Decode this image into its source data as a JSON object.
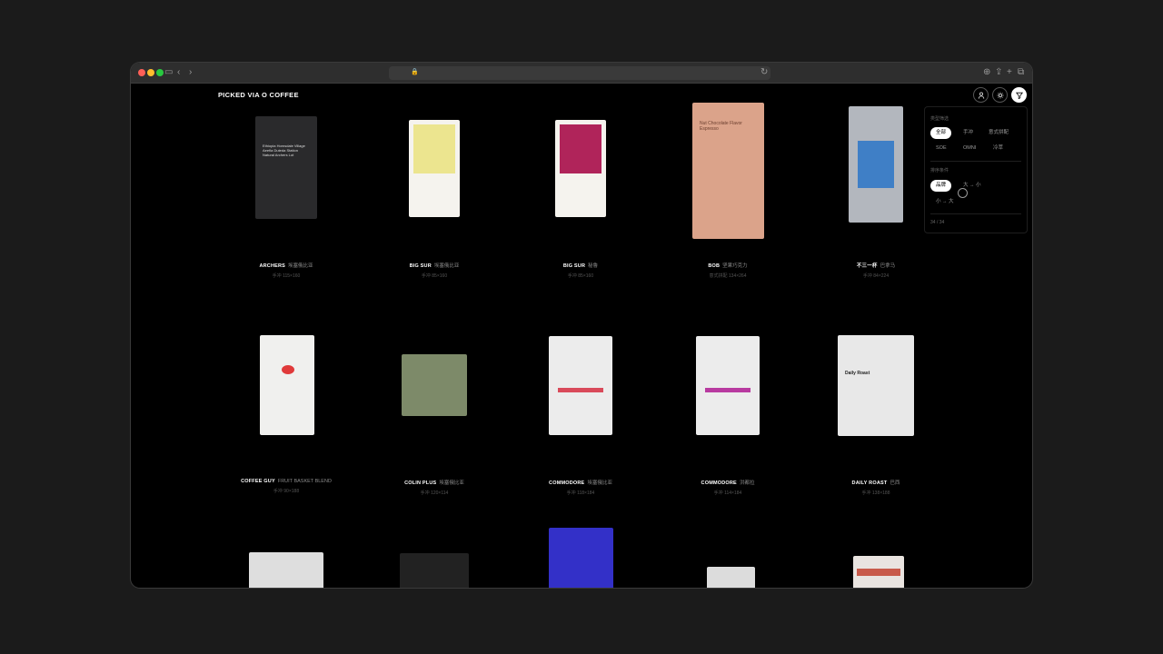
{
  "site": {
    "title": "PICKED VIA O COFFEE"
  },
  "icons": {
    "account": "user-icon",
    "theme": "sun-icon",
    "filter": "filter-icon"
  },
  "products": [
    {
      "brand": "ARCHERS",
      "name": "埃塞俄比亚",
      "type": "手冲",
      "size": "115×160",
      "bag_color": "#2a2a2c",
      "bag_text": "Ethiopia Hornsdale Village Aeefia Duteda Station Natural Archers Lot"
    },
    {
      "brand": "BIG SUR",
      "name": "埃塞俄比亚",
      "type": "手冲",
      "size": "85×160",
      "bag_color": "#f5f3ee",
      "accent": "#ece58f"
    },
    {
      "brand": "BIG SUR",
      "name": "秘鲁",
      "type": "手冲",
      "size": "85×160",
      "bag_color": "#f5f3ee",
      "accent": "#b0245a"
    },
    {
      "brand": "BOB",
      "name": "坚果巧克力",
      "type": "意式拼配",
      "size": "134×264",
      "bag_color": "#dba38a",
      "bag_text": "Nut Chocolate Flavor Espresso"
    },
    {
      "brand": "不三一杯",
      "name": "巴拿马",
      "type": "手冲",
      "size": "84×224",
      "bag_color": "#b3b7be",
      "accent": "#3f7fc6"
    },
    {
      "brand": "COFFEE GUY",
      "name": "FRUIT BASKET BLEND",
      "type": "手冲",
      "size": "90×188",
      "bag_color": "#f0f0ee",
      "accent": "#e03a3a"
    },
    {
      "brand": "COLIN PLUS",
      "name": "埃塞俄比亚",
      "type": "手冲",
      "size": "120×114",
      "bag_color": "#7d8a69"
    },
    {
      "brand": "COMMODORE",
      "name": "埃塞俄比亚",
      "type": "手冲",
      "size": "118×184",
      "bag_color": "#ececec",
      "accent": "#d94a5a"
    },
    {
      "brand": "COMMODORE",
      "name": "洪都拉",
      "type": "手冲",
      "size": "114×184",
      "bag_color": "#ececec",
      "accent": "#b83aa0"
    },
    {
      "brand": "DAILY ROAST",
      "name": "巴西",
      "type": "手冲",
      "size": "138×188",
      "bag_color": "#e8e8e8",
      "bag_text": "Daily Roast"
    },
    {
      "bag_color": "#dedede"
    },
    {
      "bag_color": "#222222"
    },
    {
      "bag_color": "#3330c8"
    },
    {
      "bag_color": "#dcdcdc"
    },
    {
      "bag_color": "#e9e4e0",
      "accent": "#c85a4a"
    }
  ],
  "filter": {
    "type_label": "类型筛选",
    "type_options": [
      "全部",
      "手冲",
      "意式拼配",
      "SOE",
      "OMNI",
      "冷萃"
    ],
    "sort_label": "排序条件",
    "sort_options": [
      "品牌",
      "大 → 小",
      "小 → 大"
    ],
    "count": "34 / 34"
  }
}
